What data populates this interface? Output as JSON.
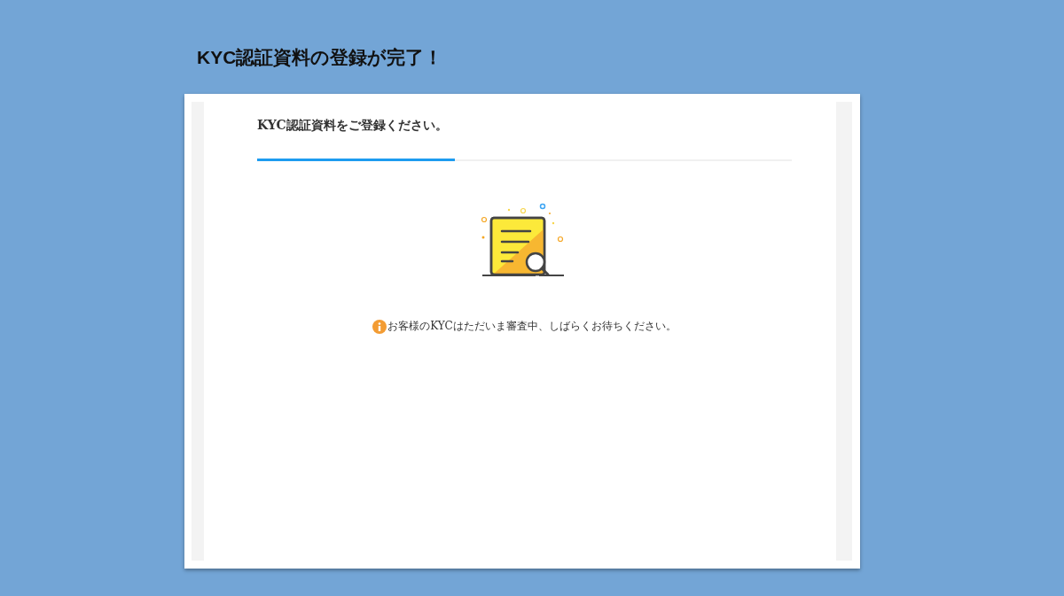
{
  "slide": {
    "title": "KYC認証資料の登録が完了！"
  },
  "panel": {
    "heading": "KYC認証資料をご登録ください。",
    "progress": {
      "level": 0.37
    },
    "message": "お客様のKYCはただいま審査中、しばらくお待ちください。"
  }
}
